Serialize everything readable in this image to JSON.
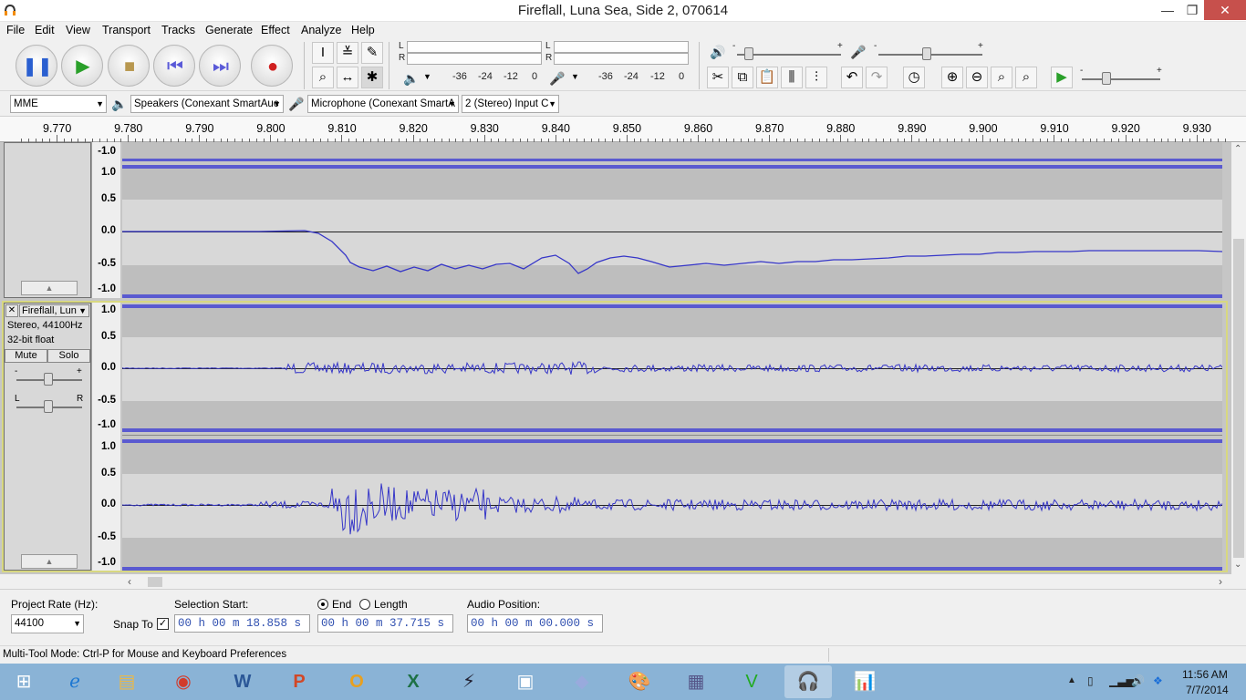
{
  "window": {
    "title": "Fireflall, Luna Sea, Side 2, 070614",
    "minimize": "—",
    "maximize": "❐",
    "close": "✕"
  },
  "menu": [
    "File",
    "Edit",
    "View",
    "Transport",
    "Tracks",
    "Generate",
    "Effect",
    "Analyze",
    "Help"
  ],
  "meters": {
    "L": "L",
    "R": "R",
    "scale": [
      "-36",
      "-24",
      "-12",
      "0"
    ]
  },
  "volume": {
    "minus": "-",
    "plus": "+"
  },
  "devices": {
    "host": "MME",
    "output": "Speakers (Conexant SmartAuc",
    "input": "Microphone (Conexant SmartA",
    "channels": "2 (Stereo) Input C"
  },
  "ruler": [
    "9.770",
    "9.780",
    "9.790",
    "9.800",
    "9.810",
    "9.820",
    "9.830",
    "9.840",
    "9.850",
    "9.860",
    "9.870",
    "9.880",
    "9.890",
    "9.900",
    "9.910",
    "9.920",
    "9.930"
  ],
  "scale": {
    "p1": "1.0",
    "p05": "0.5",
    "z": "0.0",
    "m05": "-0.5",
    "m1": "-1.0"
  },
  "track": {
    "name": "Fireflall, Lun",
    "info": "Stereo, 44100Hz",
    "format": "32-bit float",
    "mute": "Mute",
    "solo": "Solo",
    "gain_minus": "-",
    "gain_plus": "+",
    "pan_l": "L",
    "pan_r": "R",
    "close": "✕",
    "menu_arrow": "▼",
    "collapse": "▲"
  },
  "selection": {
    "rate_label": "Project Rate (Hz):",
    "rate": "44100",
    "snap_label": "Snap To",
    "start_label": "Selection Start:",
    "end_label": "End",
    "length_label": "Length",
    "position_label": "Audio Position:",
    "start": "00 h 00 m 18.858 s",
    "end": "00 h 00 m 37.715 s",
    "position": "00 h 00 m 00.000 s"
  },
  "status": "Multi-Tool Mode: Ctrl-P for Mouse and Keyboard Preferences",
  "clock": {
    "time": "11:56 AM",
    "date": "7/7/2014"
  },
  "colors": {
    "waveform": "#3636c8",
    "selected_border": "#f0f0a0",
    "track_bg": "#c6c6c6"
  }
}
